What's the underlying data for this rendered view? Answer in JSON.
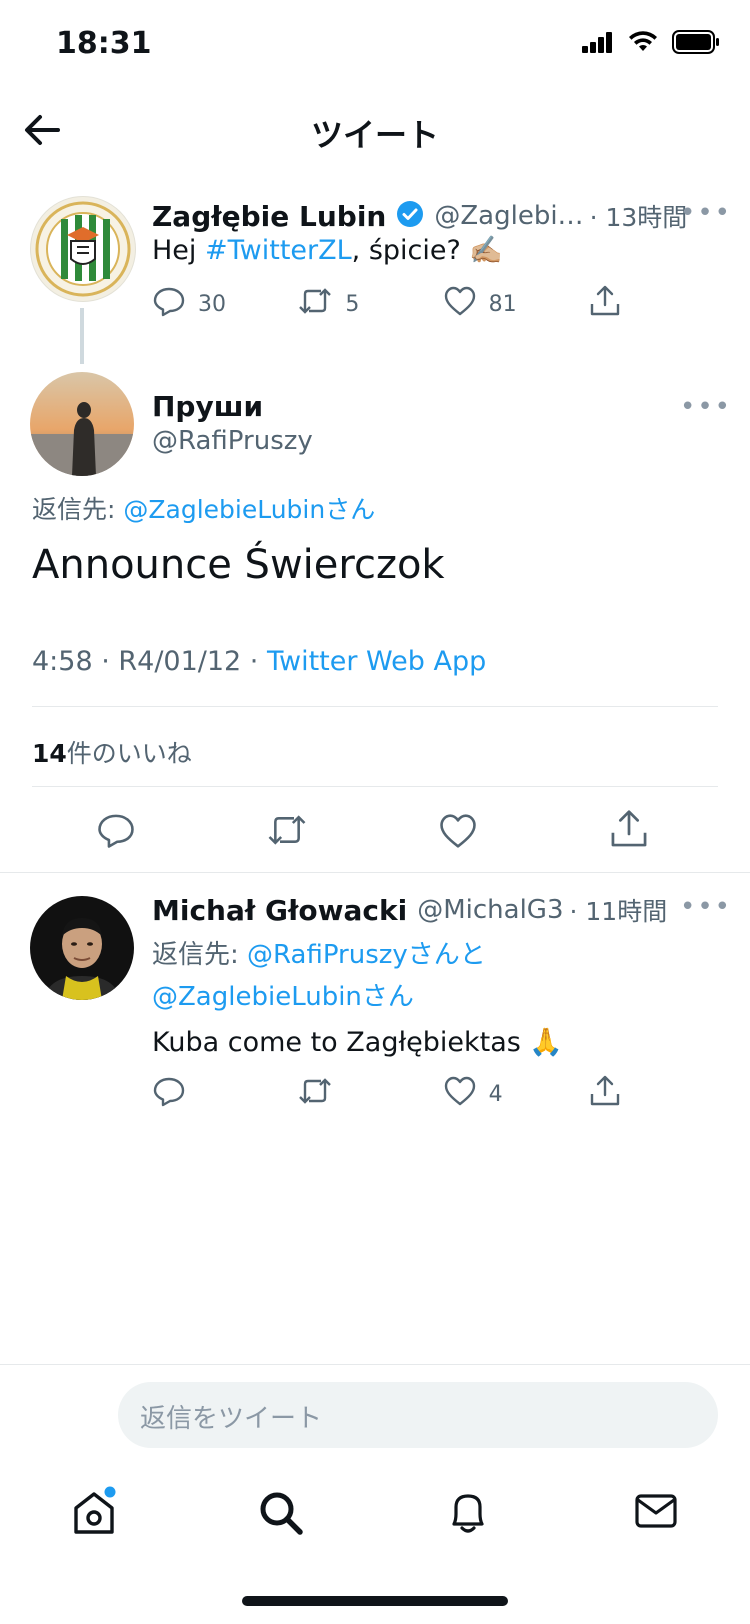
{
  "status_bar": {
    "time": "18:31"
  },
  "nav": {
    "title": "ツイート"
  },
  "parent_tweet": {
    "name": "Zagłębie Lubin",
    "handle": "@Zaglebi…",
    "time": "· 13時間",
    "more": "•••",
    "text_prefix": "Hej ",
    "hashtag": "#TwitterZL",
    "text_suffix": ", śpicie? ✍🏼",
    "replies": "30",
    "retweets": "5",
    "likes": "81"
  },
  "main_tweet": {
    "name": "Пруши",
    "handle": "@RafiPruszy",
    "more": "•••",
    "reply_to_label": "返信先: ",
    "reply_to_user": "@ZaglebieLubinさん",
    "text": "Announce Świerczok",
    "timestamp": "4:58 · R4/01/12 · ",
    "source": "Twitter Web App",
    "likes_count": "14",
    "likes_label": "件のいいね"
  },
  "reply_tweet": {
    "name": "Michał Głowacki",
    "handle": "@MichalG3",
    "time": "· 11時間",
    "more": "•••",
    "reply_to_label": "返信先: ",
    "reply_to_user1": "@RafiPruszyさんと",
    "reply_to_user2": "@ZaglebieLubinさん",
    "text": "Kuba come to Zagłębiektas 🙏",
    "likes": "4"
  },
  "composer": {
    "placeholder": "返信をツイート"
  },
  "tabbar": {
    "items": [
      "home-icon",
      "search-icon",
      "bell-icon",
      "mail-icon"
    ]
  },
  "colors": {
    "accent": "#1d9bf0",
    "muted": "#536471",
    "verified": "#1d9bf0"
  }
}
